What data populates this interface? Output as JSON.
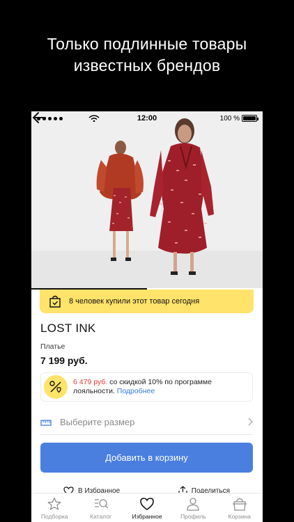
{
  "promo": {
    "line1": "Только подлинные товары",
    "line2": "известных брендов"
  },
  "status_bar": {
    "time": "12:00",
    "battery": "100 %"
  },
  "gallery": {
    "progress": 0.5
  },
  "banner": {
    "text": "8 человек купили этот товар сегодня",
    "color": "#ffe36a"
  },
  "product": {
    "brand": "LOST INK",
    "category": "Платье",
    "price": "7 199 руб."
  },
  "loyalty": {
    "discount_price": "6 479 руб.",
    "text_a": " со скидкой 10% по программе",
    "text_b": "лояльности. ",
    "link": "Подробнее",
    "accent_red": "#e53935",
    "link_color": "#3a77e0"
  },
  "size_selector": {
    "placeholder": "Выберите размер"
  },
  "cart_button": {
    "label": "Добавить в корзину",
    "color": "#4a7fe0"
  },
  "actions": {
    "favorite": "В Избранное",
    "share": "Поделиться"
  },
  "tabs": [
    {
      "label": "Подборка",
      "icon": "star-icon",
      "active": false
    },
    {
      "label": "Каталог",
      "icon": "catalog-search-icon",
      "active": false
    },
    {
      "label": "Избранное",
      "icon": "heart-icon",
      "active": true
    },
    {
      "label": "Профиль",
      "icon": "person-icon",
      "active": false
    },
    {
      "label": "Корзина",
      "icon": "cart-bag-icon",
      "active": false
    }
  ]
}
